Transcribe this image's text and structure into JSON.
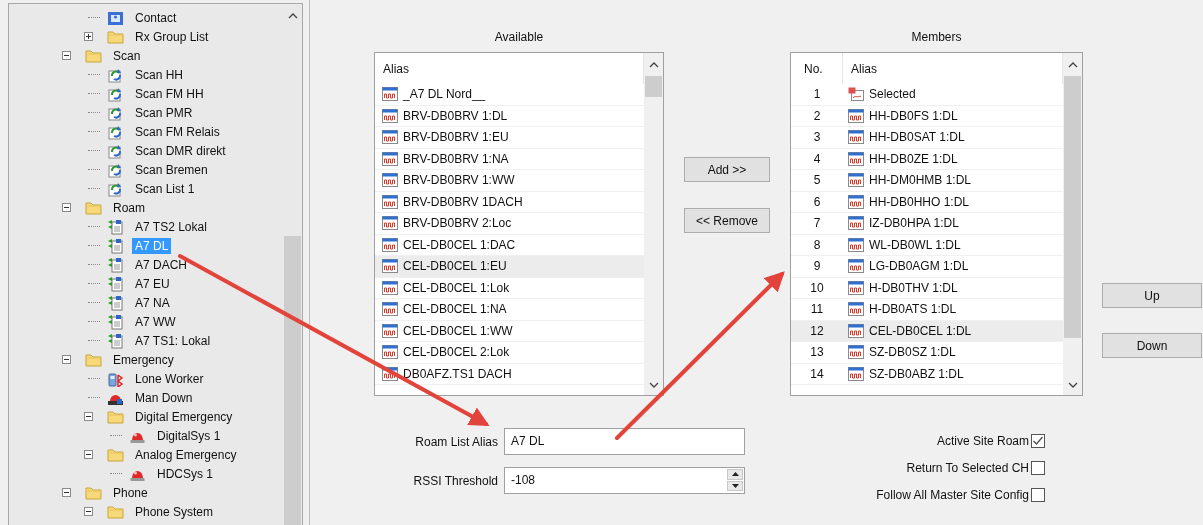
{
  "tree": {
    "continued_children": [
      {
        "label": "Contact",
        "kind": "contact",
        "selected": false
      },
      {
        "label": "Rx Group List",
        "kind": "folder",
        "expanded": false,
        "selected": false
      }
    ],
    "nodes": [
      {
        "label": "Scan",
        "kind": "folder",
        "expanded": true,
        "selected": false,
        "children": [
          {
            "label": "Scan HH",
            "kind": "scan",
            "selected": false
          },
          {
            "label": "Scan FM HH",
            "kind": "scan",
            "selected": false
          },
          {
            "label": "Scan PMR",
            "kind": "scan",
            "selected": false
          },
          {
            "label": "Scan FM Relais",
            "kind": "scan",
            "selected": false
          },
          {
            "label": "Scan DMR direkt",
            "kind": "scan",
            "selected": false
          },
          {
            "label": "Scan Bremen",
            "kind": "scan",
            "selected": false
          },
          {
            "label": "Scan List 1",
            "kind": "scan",
            "selected": false
          }
        ]
      },
      {
        "label": "Roam",
        "kind": "folder",
        "expanded": true,
        "selected": false,
        "children": [
          {
            "label": "A7 TS2 Lokal",
            "kind": "roam",
            "selected": false
          },
          {
            "label": "A7 DL",
            "kind": "roam",
            "selected": true
          },
          {
            "label": "A7 DACH",
            "kind": "roam",
            "selected": false
          },
          {
            "label": "A7 EU",
            "kind": "roam",
            "selected": false
          },
          {
            "label": "A7 NA",
            "kind": "roam",
            "selected": false
          },
          {
            "label": "A7 WW",
            "kind": "roam",
            "selected": false
          },
          {
            "label": "A7 TS1: Lokal",
            "kind": "roam",
            "selected": false
          }
        ]
      },
      {
        "label": "Emergency",
        "kind": "folder",
        "expanded": true,
        "selected": false,
        "children": [
          {
            "label": "Lone Worker",
            "kind": "lone-worker",
            "selected": false
          },
          {
            "label": "Man Down",
            "kind": "man-down",
            "selected": false
          },
          {
            "label": "Digital Emergency",
            "kind": "folder",
            "expanded": true,
            "selected": false,
            "children": [
              {
                "label": "DigitalSys 1",
                "kind": "alarm",
                "selected": false
              }
            ]
          },
          {
            "label": "Analog Emergency",
            "kind": "folder",
            "expanded": true,
            "selected": false,
            "children": [
              {
                "label": "HDCSys 1",
                "kind": "alarm",
                "selected": false
              }
            ]
          }
        ]
      },
      {
        "label": "Phone",
        "kind": "folder",
        "expanded": true,
        "selected": false,
        "children": [
          {
            "label": "Phone System",
            "kind": "folder",
            "expanded": true,
            "selected": false
          }
        ]
      }
    ]
  },
  "available": {
    "title": "Available",
    "columns": [
      "Alias"
    ],
    "rows": [
      {
        "alias": "_A7 DL Nord__",
        "kind": "channel",
        "selected": false
      },
      {
        "alias": "BRV-DB0BRV 1:DL",
        "kind": "channel",
        "selected": false
      },
      {
        "alias": "BRV-DB0BRV 1:EU",
        "kind": "channel",
        "selected": false
      },
      {
        "alias": "BRV-DB0BRV 1:NA",
        "kind": "channel",
        "selected": false
      },
      {
        "alias": "BRV-DB0BRV 1:WW",
        "kind": "channel",
        "selected": false
      },
      {
        "alias": "BRV-DB0BRV 1DACH",
        "kind": "channel",
        "selected": false
      },
      {
        "alias": "BRV-DB0BRV 2:Loc",
        "kind": "channel",
        "selected": false
      },
      {
        "alias": "CEL-DB0CEL 1:DAC",
        "kind": "channel",
        "selected": false
      },
      {
        "alias": "CEL-DB0CEL 1:EU",
        "kind": "channel",
        "selected": true
      },
      {
        "alias": "CEL-DB0CEL 1:Lok",
        "kind": "channel",
        "selected": false
      },
      {
        "alias": "CEL-DB0CEL 1:NA",
        "kind": "channel",
        "selected": false
      },
      {
        "alias": "CEL-DB0CEL 1:WW",
        "kind": "channel",
        "selected": false
      },
      {
        "alias": "CEL-DB0CEL 2:Lok",
        "kind": "channel",
        "selected": false
      },
      {
        "alias": "DB0AFZ.TS1 DACH",
        "kind": "channel",
        "selected": false
      }
    ]
  },
  "members": {
    "title": "Members",
    "columns": [
      "No.",
      "Alias"
    ],
    "rows": [
      {
        "no": "1",
        "alias": "Selected",
        "kind": "selected-channel",
        "selected": false
      },
      {
        "no": "2",
        "alias": "HH-DB0FS 1:DL",
        "kind": "channel",
        "selected": false
      },
      {
        "no": "3",
        "alias": "HH-DB0SAT 1:DL",
        "kind": "channel",
        "selected": false
      },
      {
        "no": "4",
        "alias": "HH-DB0ZE 1:DL",
        "kind": "channel",
        "selected": false
      },
      {
        "no": "5",
        "alias": "HH-DM0HMB 1:DL",
        "kind": "channel",
        "selected": false
      },
      {
        "no": "6",
        "alias": "HH-DB0HHO 1:DL",
        "kind": "channel",
        "selected": false
      },
      {
        "no": "7",
        "alias": "IZ-DB0HPA 1:DL",
        "kind": "channel",
        "selected": false
      },
      {
        "no": "8",
        "alias": "WL-DB0WL 1:DL",
        "kind": "channel",
        "selected": false
      },
      {
        "no": "9",
        "alias": "LG-DB0AGM 1:DL",
        "kind": "channel",
        "selected": false
      },
      {
        "no": "10",
        "alias": "H-DB0THV 1:DL",
        "kind": "channel",
        "selected": false
      },
      {
        "no": "11",
        "alias": "H-DB0ATS 1:DL",
        "kind": "channel",
        "selected": false
      },
      {
        "no": "12",
        "alias": "CEL-DB0CEL 1:DL",
        "kind": "channel",
        "selected": true
      },
      {
        "no": "13",
        "alias": "SZ-DB0SZ 1:DL",
        "kind": "channel",
        "selected": false
      },
      {
        "no": "14",
        "alias": "SZ-DB0ABZ 1:DL",
        "kind": "channel",
        "selected": false
      }
    ]
  },
  "buttons": {
    "add": "Add >>",
    "remove": "<< Remove",
    "up": "Up",
    "down": "Down"
  },
  "fields": [
    {
      "label": "Roam List Alias",
      "value": "A7 DL",
      "kind": "text"
    },
    {
      "label": "RSSI Threshold",
      "value": "-108",
      "kind": "spinner"
    }
  ],
  "options": [
    {
      "label": "Active Site Roam",
      "checked": true
    },
    {
      "label": "Return To Selected CH",
      "checked": false
    },
    {
      "label": "Follow All Master Site Config",
      "checked": false
    }
  ]
}
